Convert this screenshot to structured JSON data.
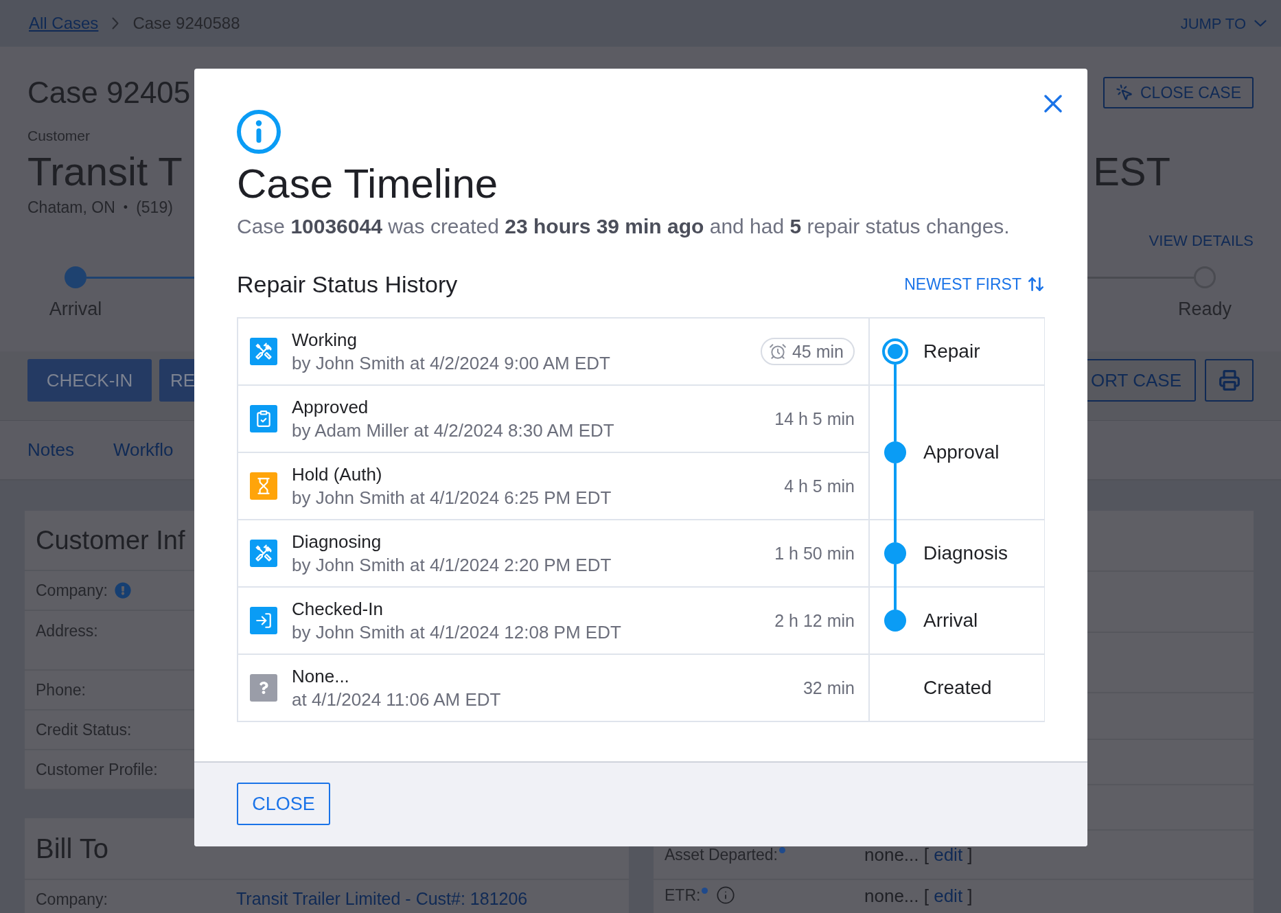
{
  "breadcrumb": {
    "link": "All Cases",
    "current": "Case 9240588"
  },
  "jump_to": "JUMP TO",
  "header": {
    "title": "Case 92405",
    "close_case": "CLOSE CASE",
    "customer_label": "Customer",
    "customer_name_start": "Transit T",
    "customer_name_end": "EST",
    "location": "Chatam, ON",
    "separator": "•",
    "phone": "(519)",
    "view_details": "VIEW DETAILS"
  },
  "progress": [
    {
      "label": "Arrival",
      "reached": true
    },
    {
      "label": "Ready",
      "reached": false
    }
  ],
  "actions": {
    "left": [
      "CHECK-IN",
      "RE"
    ],
    "right": "ORT CASE"
  },
  "tabs": [
    {
      "label": "Notes"
    },
    {
      "label": "Workflo"
    }
  ],
  "customer_card": {
    "title": "Customer Inf",
    "rows": [
      {
        "label": "Company:",
        "kind": "alert"
      },
      {
        "label": "Address:",
        "kind": "multiline"
      },
      {
        "label": "Phone:",
        "kind": "plain"
      },
      {
        "label": "Credit Status:",
        "kind": "plain"
      },
      {
        "label": "Customer Profile:",
        "kind": "plain"
      }
    ]
  },
  "bill_to_card": {
    "title": "Bill To",
    "rows": [
      {
        "label": "Company:",
        "value": "Transit Trailer Limited - Cust#: 181206"
      }
    ]
  },
  "asset_card": {
    "rows": [
      {
        "label": "Asset Departed:",
        "required": true,
        "info": false,
        "value": "none... [",
        "link": "edit",
        "end": "]"
      },
      {
        "label": "ETR:",
        "required": true,
        "info": true,
        "value": "none... [",
        "link": "edit",
        "end": "]"
      }
    ]
  },
  "modal": {
    "title": "Case Timeline",
    "summary": "Case **10036044** was created **23 hours 39 min ago** and had **5** repair status changes.",
    "section_title": "Repair Status History",
    "sort_label": "NEWEST FIRST",
    "phases": [
      {
        "label": "Repair",
        "kind": "current",
        "entries": [
          {
            "status": "Working",
            "detail": "by John Smith at 4/2/2024 9:00 AM EDT",
            "duration": "45 min",
            "kind": "tools",
            "running": true
          }
        ]
      },
      {
        "label": "Approval",
        "kind": "done",
        "entries": [
          {
            "status": "Approved",
            "detail": "by Adam Miller at 4/2/2024 8:30 AM EDT",
            "duration": "14 h 5 min",
            "kind": "approval",
            "running": false
          },
          {
            "status": "Hold (Auth)",
            "detail": "by John Smith at 4/1/2024 6:25 PM EDT",
            "duration": "4 h 5 min",
            "kind": "hold",
            "running": false
          }
        ]
      },
      {
        "label": "Diagnosis",
        "kind": "done",
        "entries": [
          {
            "status": "Diagnosing",
            "detail": "by John Smith at 4/1/2024 2:20 PM EDT",
            "duration": "1 h 50 min",
            "kind": "tools",
            "running": false
          }
        ]
      },
      {
        "label": "Arrival",
        "kind": "done",
        "entries": [
          {
            "status": "Checked-In",
            "detail": "by John Smith at 4/1/2024 12:08 PM EDT",
            "duration": "2 h 12 min",
            "kind": "checkin",
            "running": false
          }
        ]
      },
      {
        "label": "Created",
        "kind": "start",
        "entries": [
          {
            "status": "None...",
            "detail": "at 4/1/2024 11:06 AM EDT",
            "duration": "32 min",
            "kind": "unknown",
            "running": false
          }
        ]
      }
    ],
    "close_button": "CLOSE"
  }
}
